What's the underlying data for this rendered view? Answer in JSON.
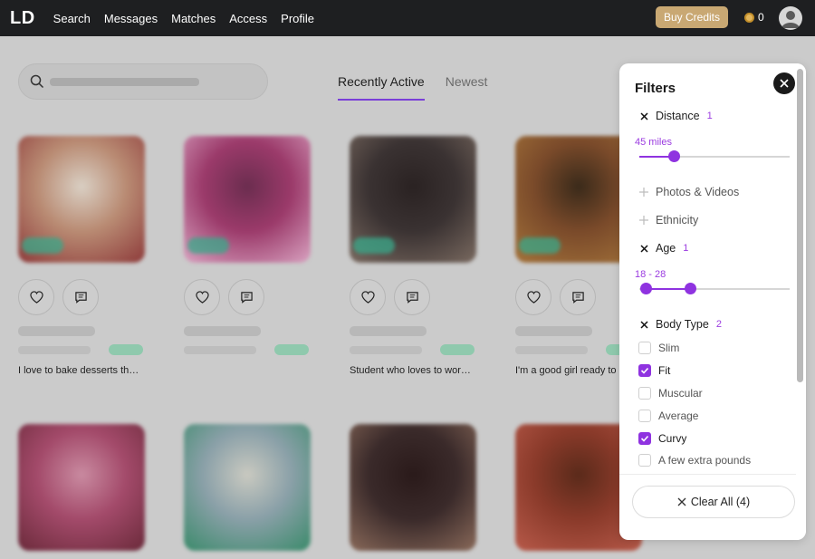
{
  "nav": {
    "logo": "LD",
    "links": [
      "Search",
      "Messages",
      "Matches",
      "Access",
      "Profile"
    ],
    "buy_label": "Buy Credits",
    "credits": "0",
    "icons": {
      "coin": "coin-icon",
      "avatar": "user-avatar-icon"
    }
  },
  "search": {
    "placeholder_icon": "search-icon"
  },
  "tabs": [
    {
      "label": "Recently Active",
      "active": true
    },
    {
      "label": "Newest",
      "active": false
    }
  ],
  "cards": [
    {
      "bio": "I love to bake desserts th…",
      "colors": [
        "#b98b73",
        "#8d3a3a",
        "#d9cfc3"
      ]
    },
    {
      "bio": "",
      "colors": [
        "#9b3a6a",
        "#d9a3c1",
        "#6b2d4f"
      ]
    },
    {
      "bio": "Student who loves to wor…",
      "colors": [
        "#3a3232",
        "#7a6a60",
        "#2a2222"
      ]
    },
    {
      "bio": "I'm a good girl ready to …",
      "colors": [
        "#7a4a2a",
        "#a4733a",
        "#3a2a1a"
      ]
    },
    {
      "bio": "",
      "colors": [
        "#a34a6a",
        "#6a2a3a",
        "#c98aa0"
      ]
    },
    {
      "bio": "",
      "colors": [
        "#8aa0a8",
        "#3a8a6a",
        "#c9c9c0"
      ]
    },
    {
      "bio": "",
      "colors": [
        "#3a2a2a",
        "#8a6a5a",
        "#2a1a1a"
      ]
    },
    {
      "bio": "",
      "colors": [
        "#8a3a2a",
        "#b85a4a",
        "#5a2a1a"
      ]
    }
  ],
  "filters": {
    "title": "Filters",
    "distance": {
      "label": "Distance",
      "count": "1",
      "value_label": "45 miles",
      "value_fraction": 0.23
    },
    "photos": {
      "label": "Photos & Videos"
    },
    "ethnicity": {
      "label": "Ethnicity"
    },
    "age": {
      "label": "Age",
      "count": "1",
      "value_label": "18 - 28",
      "min_fraction": 0.04,
      "max_fraction": 0.34
    },
    "body_type": {
      "label": "Body Type",
      "count": "2",
      "options": [
        {
          "label": "Slim",
          "checked": false
        },
        {
          "label": "Fit",
          "checked": true
        },
        {
          "label": "Muscular",
          "checked": false
        },
        {
          "label": "Average",
          "checked": false
        },
        {
          "label": "Curvy",
          "checked": true
        },
        {
          "label": "A few extra pounds",
          "checked": false
        }
      ]
    },
    "clear_label": "Clear All (4)"
  },
  "colors": {
    "accent": "#8f33e0",
    "nav_bg": "#1e1f21",
    "buy_btn": "#c9a873"
  }
}
